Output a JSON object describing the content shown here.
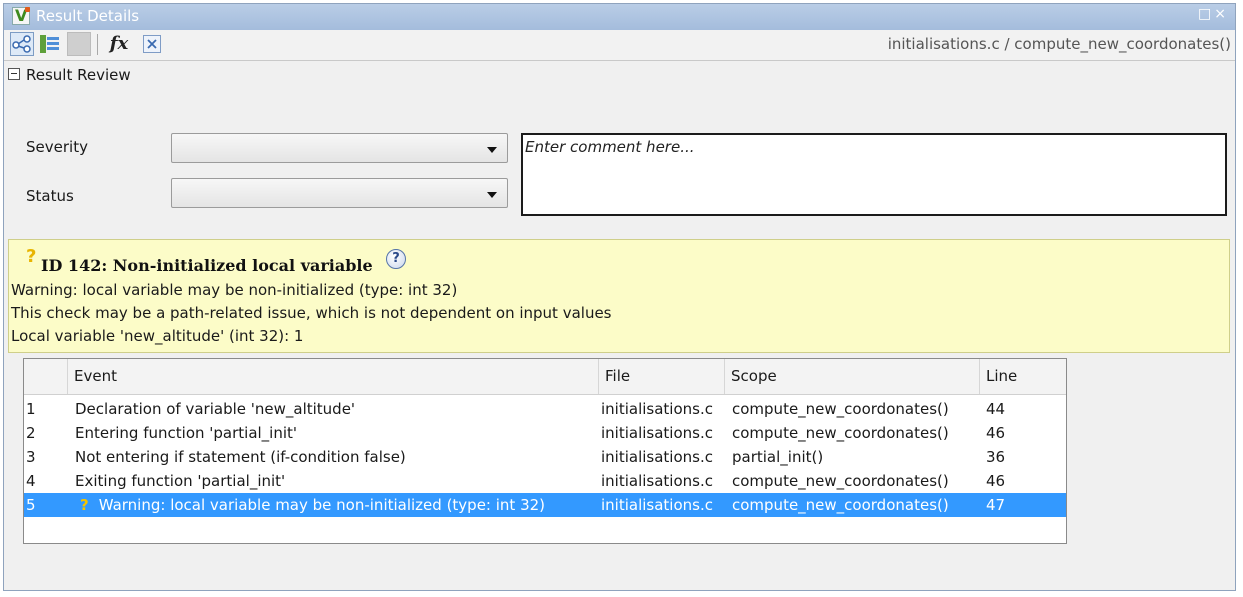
{
  "window": {
    "title": "Result Details",
    "controls": "□×",
    "app_icon": "polyspace-v-icon"
  },
  "toolbar": {
    "breadcrumb": "initialisations.c / compute_new_coordonates()",
    "formula_label": "fx",
    "icons": [
      "event-graph-icon",
      "list-view-icon",
      "disabled-icon",
      "fx-icon",
      "variable-icon"
    ]
  },
  "review": {
    "header": "Result Review",
    "severity_label": "Severity",
    "severity_value": "",
    "status_label": "Status",
    "status_value": "",
    "comment_placeholder": "Enter comment here..."
  },
  "result": {
    "marker": "?",
    "title": "ID 142: Non-initialized local variable",
    "help": "?",
    "lines": [
      "Warning: local variable may be non-initialized (type: int 32)",
      "This check may be a path-related issue, which is not dependent on input values",
      "Local variable 'new_altitude' (int 32): 1"
    ]
  },
  "events": {
    "columns": [
      "",
      "Event",
      "File",
      "Scope",
      "Line"
    ],
    "rows": [
      {
        "n": "1",
        "event": "Declaration of variable 'new_altitude'",
        "file": "initialisations.c",
        "scope": "compute_new_coordonates()",
        "line": "44",
        "warning": false
      },
      {
        "n": "2",
        "event": "Entering function 'partial_init'",
        "file": "initialisations.c",
        "scope": "compute_new_coordonates()",
        "line": "46",
        "warning": false
      },
      {
        "n": "3",
        "event": "Not entering if statement (if-condition false)",
        "file": "initialisations.c",
        "scope": "partial_init()",
        "line": "36",
        "warning": false
      },
      {
        "n": "4",
        "event": "Exiting function 'partial_init'",
        "file": "initialisations.c",
        "scope": "compute_new_coordonates()",
        "line": "46",
        "warning": false
      },
      {
        "n": "5",
        "event": "Warning: local variable may be non-initialized (type: int 32)",
        "file": "initialisations.c",
        "scope": "compute_new_coordonates()",
        "line": "47",
        "warning": true,
        "selected": true
      }
    ],
    "selection_color": "#3399ff"
  }
}
